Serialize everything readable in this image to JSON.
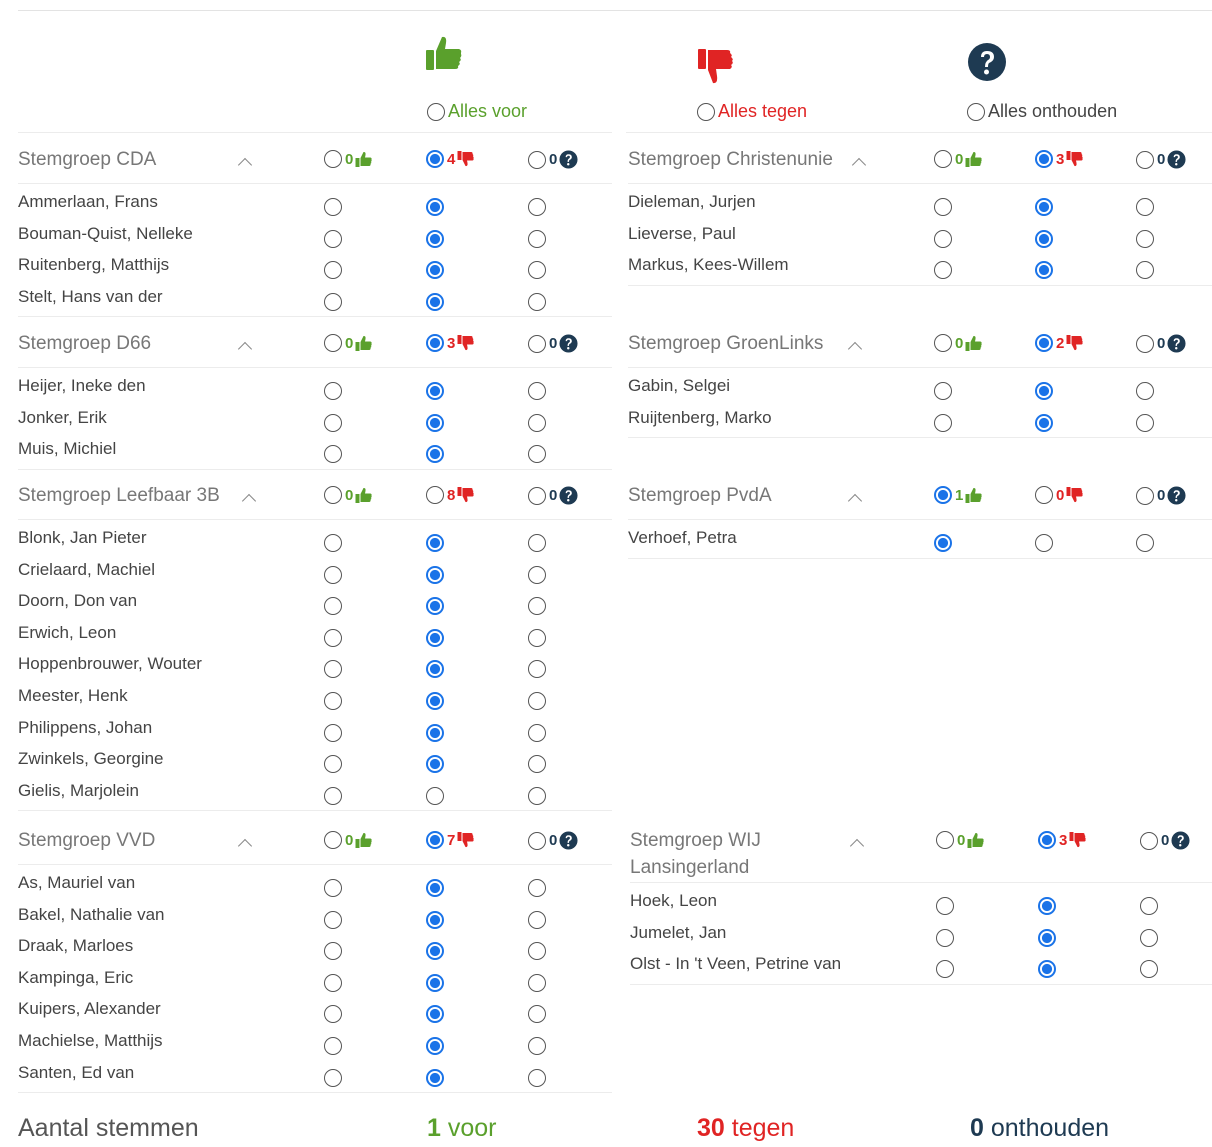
{
  "header": {
    "all_for": "Alles voor",
    "all_against": "Alles tegen",
    "all_abstain": "Alles onthouden"
  },
  "colors": {
    "for": "#5aa02c",
    "against": "#e02424",
    "abstain": "#1e3a52",
    "selected": "#1a73e8"
  },
  "icons": {
    "for": "thumbs-up-icon",
    "against": "thumbs-down-icon",
    "abstain": "question-circle-icon",
    "collapse": "chevron-up-icon"
  },
  "groups": [
    {
      "name": "Stemgroep CDA",
      "counts": {
        "for": "0",
        "against": "4",
        "abstain": "0"
      },
      "selected": "against",
      "members": [
        {
          "name": "Ammerlaan, Frans",
          "vote": "against"
        },
        {
          "name": "Bouman-Quist, Nelleke",
          "vote": "against"
        },
        {
          "name": "Ruitenberg, Matthijs",
          "vote": "against"
        },
        {
          "name": "Stelt, Hans van der",
          "vote": "against"
        }
      ]
    },
    {
      "name": "Stemgroep Christenunie",
      "counts": {
        "for": "0",
        "against": "3",
        "abstain": "0"
      },
      "selected": "against",
      "members": [
        {
          "name": "Dieleman, Jurjen",
          "vote": "against"
        },
        {
          "name": "Lieverse, Paul",
          "vote": "against"
        },
        {
          "name": "Markus, Kees-Willem",
          "vote": "against"
        }
      ]
    },
    {
      "name": "Stemgroep D66",
      "counts": {
        "for": "0",
        "against": "3",
        "abstain": "0"
      },
      "selected": "against",
      "members": [
        {
          "name": "Heijer, Ineke den",
          "vote": "against"
        },
        {
          "name": "Jonker, Erik",
          "vote": "against"
        },
        {
          "name": "Muis, Michiel",
          "vote": "against"
        }
      ]
    },
    {
      "name": "Stemgroep GroenLinks",
      "counts": {
        "for": "0",
        "against": "2",
        "abstain": "0"
      },
      "selected": "against",
      "members": [
        {
          "name": "Gabin, Selgei",
          "vote": "against"
        },
        {
          "name": "Ruijtenberg, Marko",
          "vote": "against"
        }
      ]
    },
    {
      "name": "Stemgroep Leefbaar 3B",
      "counts": {
        "for": "0",
        "against": "8",
        "abstain": "0"
      },
      "selected": "none",
      "members": [
        {
          "name": "Blonk, Jan Pieter",
          "vote": "against"
        },
        {
          "name": "Crielaard, Machiel",
          "vote": "against"
        },
        {
          "name": "Doorn, Don van",
          "vote": "against"
        },
        {
          "name": "Erwich, Leon",
          "vote": "against"
        },
        {
          "name": "Hoppenbrouwer, Wouter",
          "vote": "against"
        },
        {
          "name": "Meester, Henk",
          "vote": "against"
        },
        {
          "name": "Philippens, Johan",
          "vote": "against"
        },
        {
          "name": "Zwinkels, Georgine",
          "vote": "against"
        },
        {
          "name": "Gielis, Marjolein",
          "vote": "none"
        }
      ]
    },
    {
      "name": "Stemgroep PvdA",
      "counts": {
        "for": "1",
        "against": "0",
        "abstain": "0"
      },
      "selected": "for",
      "members": [
        {
          "name": "Verhoef, Petra",
          "vote": "for"
        }
      ]
    },
    {
      "name": "Stemgroep VVD",
      "counts": {
        "for": "0",
        "against": "7",
        "abstain": "0"
      },
      "selected": "against",
      "members": [
        {
          "name": "As, Mauriel van",
          "vote": "against"
        },
        {
          "name": "Bakel, Nathalie van",
          "vote": "against"
        },
        {
          "name": "Draak, Marloes",
          "vote": "against"
        },
        {
          "name": "Kampinga, Eric",
          "vote": "against"
        },
        {
          "name": "Kuipers, Alexander",
          "vote": "against"
        },
        {
          "name": "Machielse, Matthijs",
          "vote": "against"
        },
        {
          "name": "Santen, Ed van",
          "vote": "against"
        }
      ]
    },
    {
      "name_lines": [
        "Stemgroep WIJ",
        "Lansingerland"
      ],
      "counts": {
        "for": "0",
        "against": "3",
        "abstain": "0"
      },
      "selected": "against",
      "members": [
        {
          "name": "Hoek, Leon",
          "vote": "against"
        },
        {
          "name": "Jumelet, Jan",
          "vote": "against"
        },
        {
          "name": "Olst - In 't Veen, Petrine van",
          "vote": "against"
        }
      ]
    }
  ],
  "footer": {
    "label": "Aantal stemmen",
    "for_count": "1",
    "for_label": "voor",
    "against_count": "30",
    "against_label": "tegen",
    "abstain_count": "0",
    "abstain_label": "onthouden"
  }
}
